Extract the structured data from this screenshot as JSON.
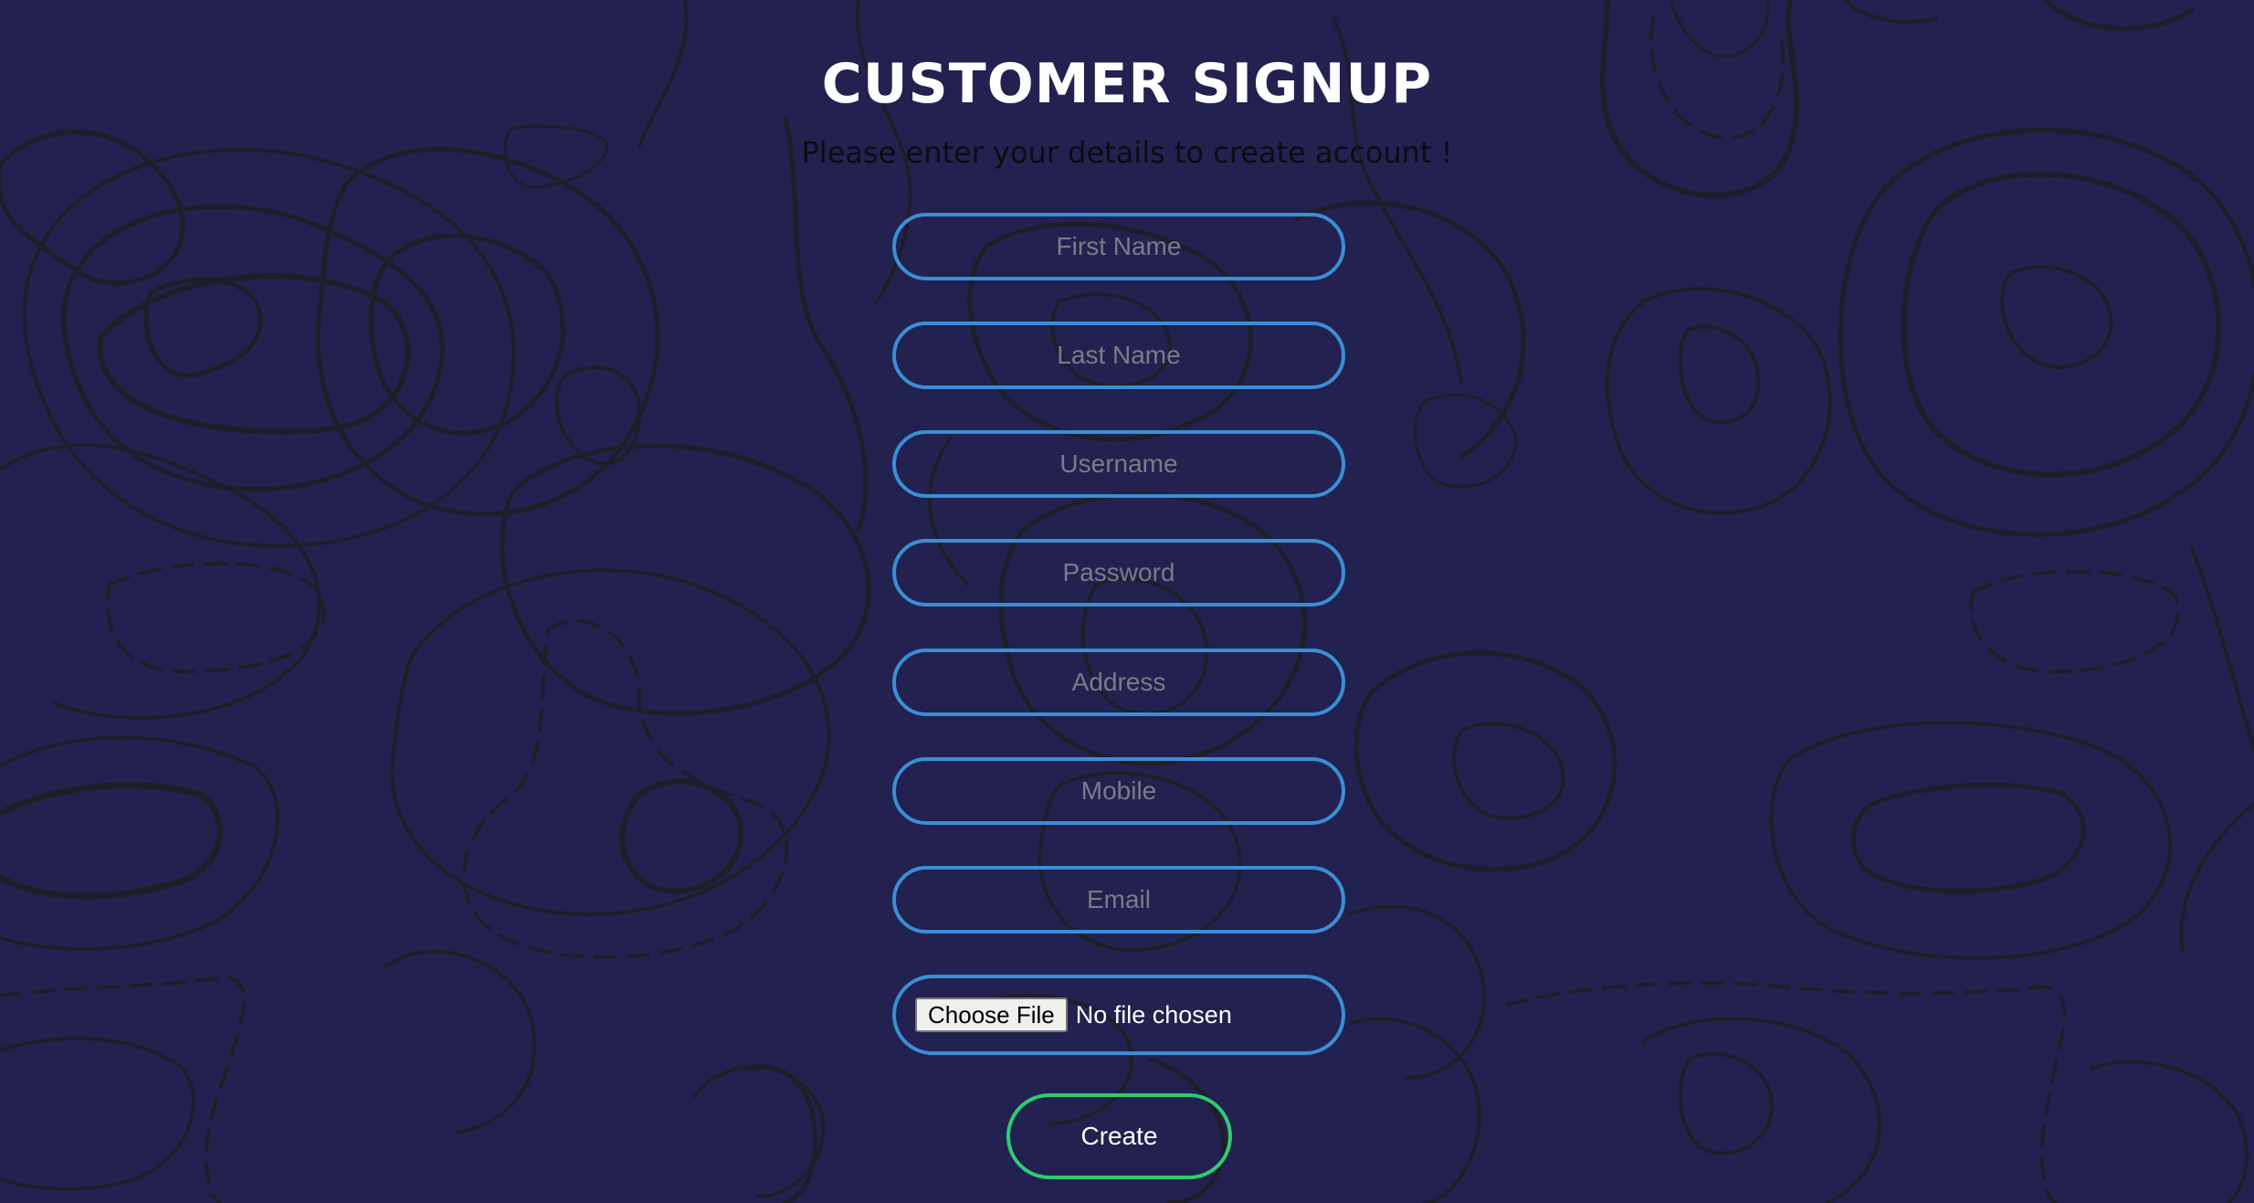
{
  "header": {
    "title": "CUSTOMER SIGNUP",
    "subtitle": "Please enter your details to create account !"
  },
  "form": {
    "fields": [
      {
        "placeholder": "First Name",
        "value": ""
      },
      {
        "placeholder": "Last Name",
        "value": ""
      },
      {
        "placeholder": "Username",
        "value": ""
      },
      {
        "placeholder": "Password",
        "value": ""
      },
      {
        "placeholder": "Address",
        "value": ""
      },
      {
        "placeholder": "Mobile",
        "value": ""
      },
      {
        "placeholder": "Email",
        "value": ""
      }
    ],
    "file": {
      "button_label": "Choose File",
      "status": "No file chosen"
    },
    "submit_label": "Create"
  },
  "colors": {
    "background": "#23214f",
    "input_border": "#3a8fd6",
    "submit_border": "#2ecc71",
    "contour_lines": "#1e1e28"
  }
}
